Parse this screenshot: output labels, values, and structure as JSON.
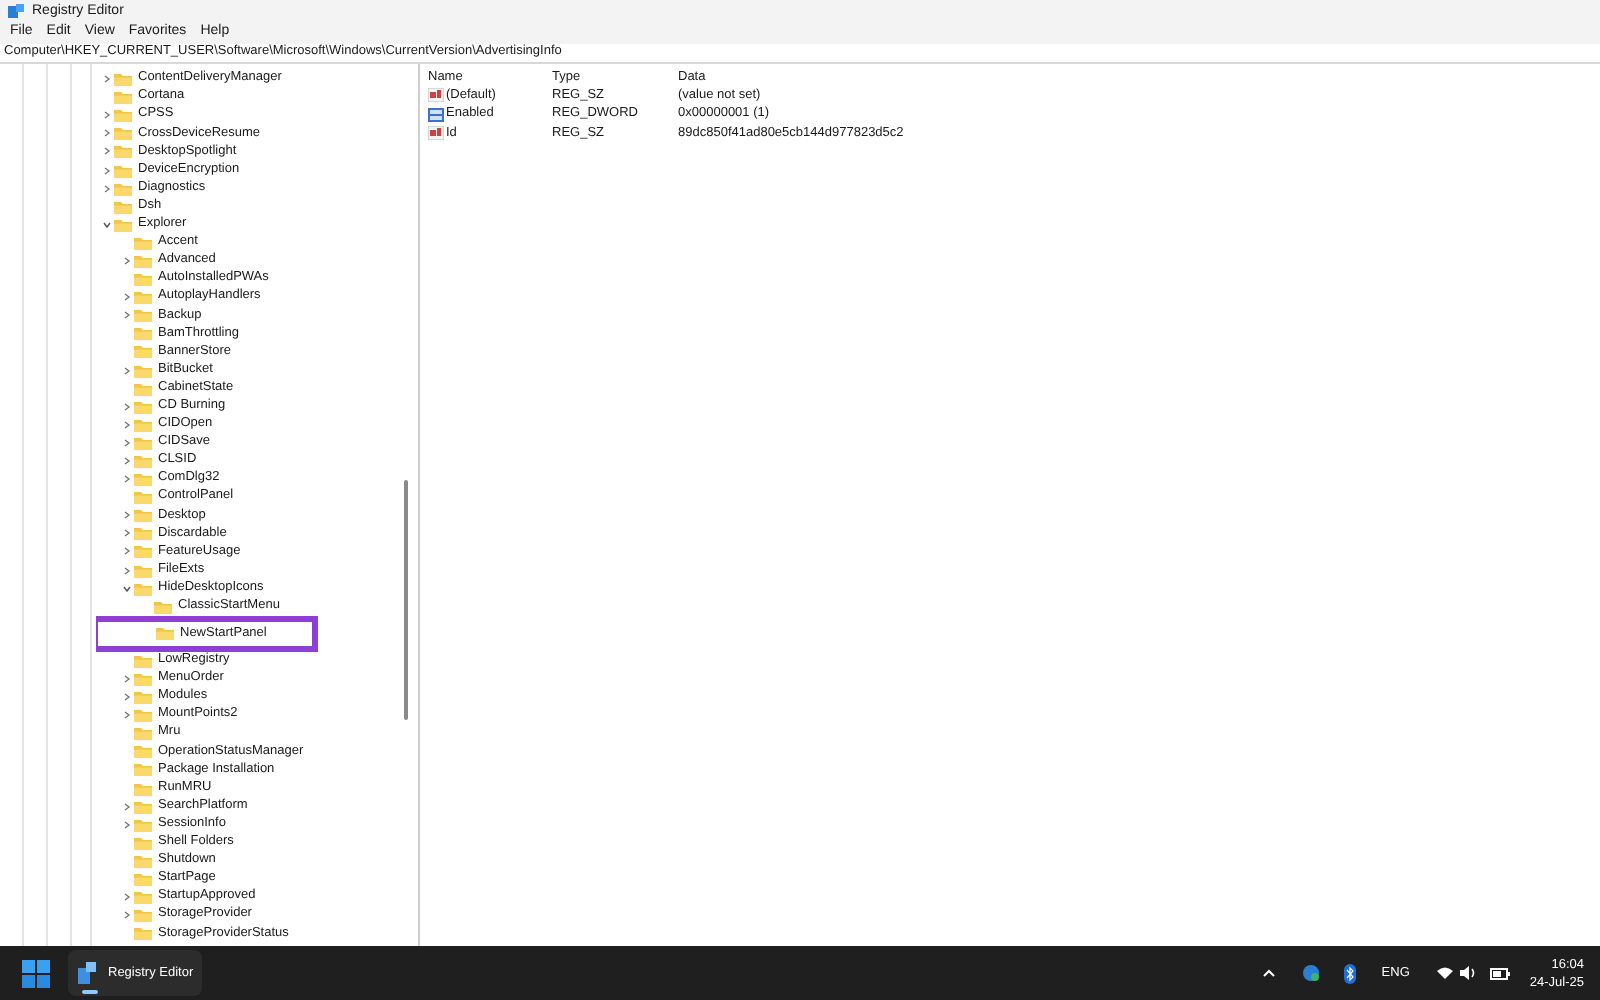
{
  "window": {
    "title": "Registry Editor"
  },
  "menu": [
    "File",
    "Edit",
    "View",
    "Favorites",
    "Help"
  ],
  "address": "Computer\\HKEY_CURRENT_USER\\Software\\Microsoft\\Windows\\CurrentVersion\\AdvertisingInfo",
  "tree": [
    {
      "label": "ContentDeliveryManager",
      "has_subkeys": true,
      "expanded": false
    },
    {
      "label": "Cortana",
      "has_subkeys": false,
      "expanded": false
    },
    {
      "label": "CPSS",
      "has_subkeys": true,
      "expanded": false
    },
    {
      "label": "CrossDeviceResume",
      "has_subkeys": true,
      "expanded": false
    },
    {
      "label": "DesktopSpotlight",
      "has_subkeys": true,
      "expanded": false
    },
    {
      "label": "DeviceEncryption",
      "has_subkeys": true,
      "expanded": false
    },
    {
      "label": "Diagnostics",
      "has_subkeys": true,
      "expanded": false
    },
    {
      "label": "Dsh",
      "has_subkeys": false,
      "expanded": false
    },
    {
      "label": "Explorer",
      "has_subkeys": true,
      "expanded": true,
      "children": [
        {
          "label": "Accent",
          "has_subkeys": false,
          "expanded": false
        },
        {
          "label": "Advanced",
          "has_subkeys": true,
          "expanded": false
        },
        {
          "label": "AutoInstalledPWAs",
          "has_subkeys": false,
          "expanded": false
        },
        {
          "label": "AutoplayHandlers",
          "has_subkeys": true,
          "expanded": false
        },
        {
          "label": "Backup",
          "has_subkeys": true,
          "expanded": false
        },
        {
          "label": "BamThrottling",
          "has_subkeys": false,
          "expanded": false
        },
        {
          "label": "BannerStore",
          "has_subkeys": false,
          "expanded": false
        },
        {
          "label": "BitBucket",
          "has_subkeys": true,
          "expanded": false
        },
        {
          "label": "CabinetState",
          "has_subkeys": false,
          "expanded": false
        },
        {
          "label": "CD Burning",
          "has_subkeys": true,
          "expanded": false
        },
        {
          "label": "CIDOpen",
          "has_subkeys": true,
          "expanded": false
        },
        {
          "label": "CIDSave",
          "has_subkeys": true,
          "expanded": false
        },
        {
          "label": "CLSID",
          "has_subkeys": true,
          "expanded": false
        },
        {
          "label": "ComDlg32",
          "has_subkeys": true,
          "expanded": false
        },
        {
          "label": "ControlPanel",
          "has_subkeys": false,
          "expanded": false
        },
        {
          "label": "Desktop",
          "has_subkeys": true,
          "expanded": false
        },
        {
          "label": "Discardable",
          "has_subkeys": true,
          "expanded": false
        },
        {
          "label": "FeatureUsage",
          "has_subkeys": true,
          "expanded": false
        },
        {
          "label": "FileExts",
          "has_subkeys": true,
          "expanded": false
        },
        {
          "label": "HideDesktopIcons",
          "has_subkeys": true,
          "expanded": true,
          "children": [
            {
              "label": "ClassicStartMenu",
              "has_subkeys": false,
              "expanded": false,
              "highlighted": false
            },
            {
              "label": "NewStartPanel",
              "has_subkeys": false,
              "expanded": false,
              "highlighted": true
            }
          ]
        },
        {
          "label": "LowRegistry",
          "has_subkeys": false,
          "expanded": false
        },
        {
          "label": "MenuOrder",
          "has_subkeys": true,
          "expanded": false
        },
        {
          "label": "Modules",
          "has_subkeys": true,
          "expanded": false
        },
        {
          "label": "MountPoints2",
          "has_subkeys": true,
          "expanded": false
        },
        {
          "label": "Mru",
          "has_subkeys": false,
          "expanded": false
        },
        {
          "label": "OperationStatusManager",
          "has_subkeys": false,
          "expanded": false
        },
        {
          "label": "Package Installation",
          "has_subkeys": false,
          "expanded": false
        },
        {
          "label": "RunMRU",
          "has_subkeys": false,
          "expanded": false
        },
        {
          "label": "SearchPlatform",
          "has_subkeys": true,
          "expanded": false
        },
        {
          "label": "SessionInfo",
          "has_subkeys": true,
          "expanded": false
        },
        {
          "label": "Shell Folders",
          "has_subkeys": false,
          "expanded": false
        },
        {
          "label": "Shutdown",
          "has_subkeys": false,
          "expanded": false
        },
        {
          "label": "StartPage",
          "has_subkeys": false,
          "expanded": false
        },
        {
          "label": "StartupApproved",
          "has_subkeys": true,
          "expanded": false
        },
        {
          "label": "StorageProvider",
          "has_subkeys": true,
          "expanded": false
        },
        {
          "label": "StorageProviderStatus",
          "has_subkeys": false,
          "expanded": false
        }
      ]
    }
  ],
  "values": {
    "columns": [
      "Name",
      "Type",
      "Data"
    ],
    "rows": [
      {
        "kind": "string",
        "name": "(Default)",
        "type": "REG_SZ",
        "data": "(value not set)"
      },
      {
        "kind": "dword",
        "name": "Enabled",
        "type": "REG_DWORD",
        "data": "0x00000001 (1)"
      },
      {
        "kind": "string",
        "name": "Id",
        "type": "REG_SZ",
        "data": "89dc850f41ad80e5cb144d977823d5c2"
      }
    ]
  },
  "taskbar": {
    "app": "Registry Editor",
    "language": "ENG",
    "time": "16:04",
    "date": "24-Jul-25"
  }
}
